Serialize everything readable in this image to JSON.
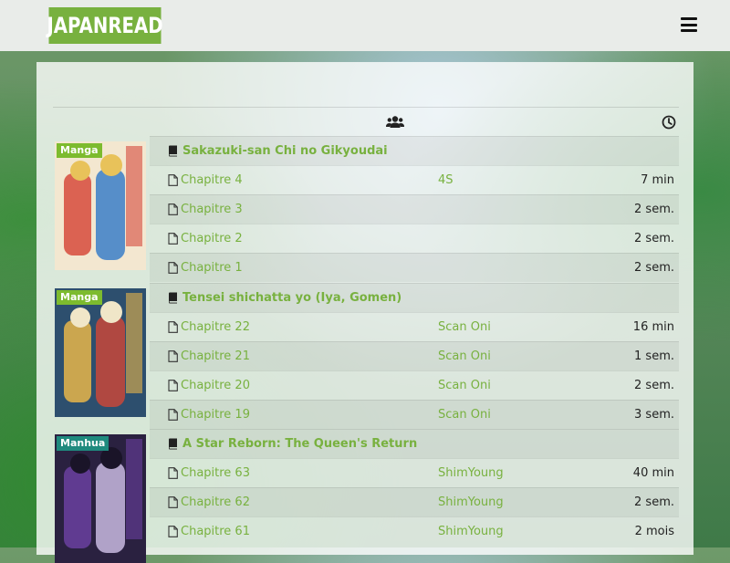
{
  "brand": {
    "name": "JAPANREAD"
  },
  "colors": {
    "accent": "#78b13f",
    "manhua_badge": "#1f8a7e"
  },
  "icons": {
    "menu": "hamburger-icon",
    "users": "users-icon",
    "clock": "clock-icon",
    "book": "book-icon",
    "file": "file-icon"
  },
  "groups": [
    {
      "type": "Manga",
      "title": "Sakazuki-san Chi no Gikyoudai",
      "chapters": [
        {
          "label": "Chapitre 4",
          "team": "4S",
          "time": "7 min"
        },
        {
          "label": "Chapitre 3",
          "team": "",
          "time": "2 sem."
        },
        {
          "label": "Chapitre 2",
          "team": "",
          "time": "2 sem."
        },
        {
          "label": "Chapitre 1",
          "team": "",
          "time": "2 sem."
        }
      ]
    },
    {
      "type": "Manga",
      "title": "Tensei shichatta yo (Iya, Gomen)",
      "chapters": [
        {
          "label": "Chapitre 22",
          "team": "Scan Oni",
          "time": "16 min"
        },
        {
          "label": "Chapitre 21",
          "team": "Scan Oni",
          "time": "1 sem."
        },
        {
          "label": "Chapitre 20",
          "team": "Scan Oni",
          "time": "2 sem."
        },
        {
          "label": "Chapitre 19",
          "team": "Scan Oni",
          "time": "3 sem."
        }
      ]
    },
    {
      "type": "Manhua",
      "title": "A Star Reborn: The Queen's Return",
      "chapters": [
        {
          "label": "Chapitre 63",
          "team": "ShimYoung",
          "time": "40 min"
        },
        {
          "label": "Chapitre 62",
          "team": "ShimYoung",
          "time": "2 sem."
        },
        {
          "label": "Chapitre 61",
          "team": "ShimYoung",
          "time": "2 mois"
        }
      ]
    }
  ]
}
